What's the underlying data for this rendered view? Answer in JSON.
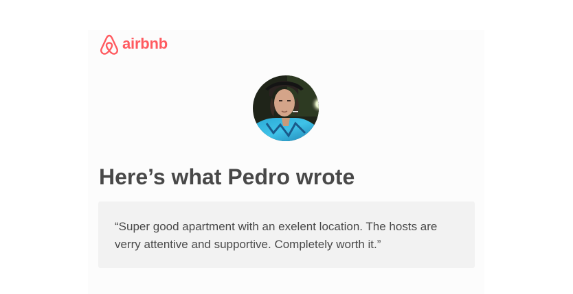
{
  "brand": {
    "name": "airbnb",
    "color": "#ff5a5f",
    "icon": "airbnb-belo-icon"
  },
  "reviewer": {
    "avatar_icon": "reviewer-avatar-photo"
  },
  "headline": "Here’s what Pedro wrote",
  "review": {
    "text": "“Super good apartment with an exelent location. The hosts are verry attentive and supportive. Completely worth it.”"
  },
  "colors": {
    "text": "#484848",
    "review_background": "#f2f2f2",
    "card_background": "#fcfcfc"
  }
}
